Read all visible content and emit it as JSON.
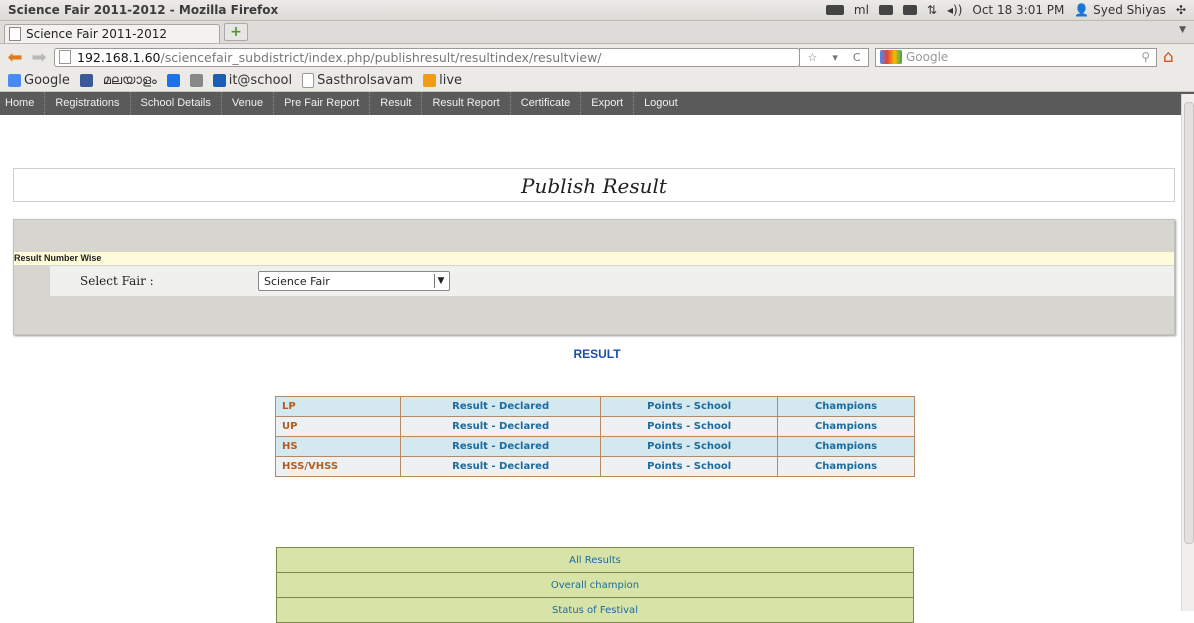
{
  "window": {
    "title": "Science Fair 2011-2012 - Mozilla Firefox",
    "tray": {
      "lang": "ml",
      "datetime": "Oct 18  3:01 PM",
      "user": "Syed Shiyas"
    }
  },
  "tab": {
    "label": "Science Fair 2011-2012",
    "new_tab": "+"
  },
  "nav": {
    "url_host": "192.168.1.60",
    "url_path": "/sciencefair_subdistrict/index.php/publishresult/resultindex/resultview/",
    "search_placeholder": "Google"
  },
  "bookmarks": [
    {
      "label": "Google",
      "color": "#4a8af4"
    },
    {
      "label": "",
      "color": "#3b5998"
    },
    {
      "label": "മലയാളം",
      "color": "#ffffff"
    },
    {
      "label": "",
      "color": "#1a73e8"
    },
    {
      "label": "",
      "color": "#888888"
    },
    {
      "label": "it@school",
      "color": "#1a5fb4"
    },
    {
      "label": "Sasthrolsavam",
      "color": "#ffffff"
    },
    {
      "label": "live",
      "color": "#f39c12"
    }
  ],
  "menu": [
    "Home",
    "Registrations",
    "School Details",
    "Venue",
    "Pre Fair Report",
    "Result",
    "Result Report",
    "Certificate",
    "Export",
    "Logout"
  ],
  "page": {
    "title": "Publish Result",
    "strip_label": "Result Number Wise",
    "select_label": "Select Fair :",
    "select_value": "Science Fair",
    "result_heading": "RESULT"
  },
  "results": [
    {
      "category": "LP",
      "declared": "Result - Declared",
      "points": "Points - School",
      "champions": "Champions"
    },
    {
      "category": "UP",
      "declared": "Result - Declared",
      "points": "Points - School",
      "champions": "Champions"
    },
    {
      "category": "HS",
      "declared": "Result - Declared",
      "points": "Points - School",
      "champions": "Champions"
    },
    {
      "category": "HSS/VHSS",
      "declared": "Result - Declared",
      "points": "Points - School",
      "champions": "Champions"
    }
  ],
  "links": [
    "All Results",
    "Overall champion",
    "Status of Festival"
  ]
}
